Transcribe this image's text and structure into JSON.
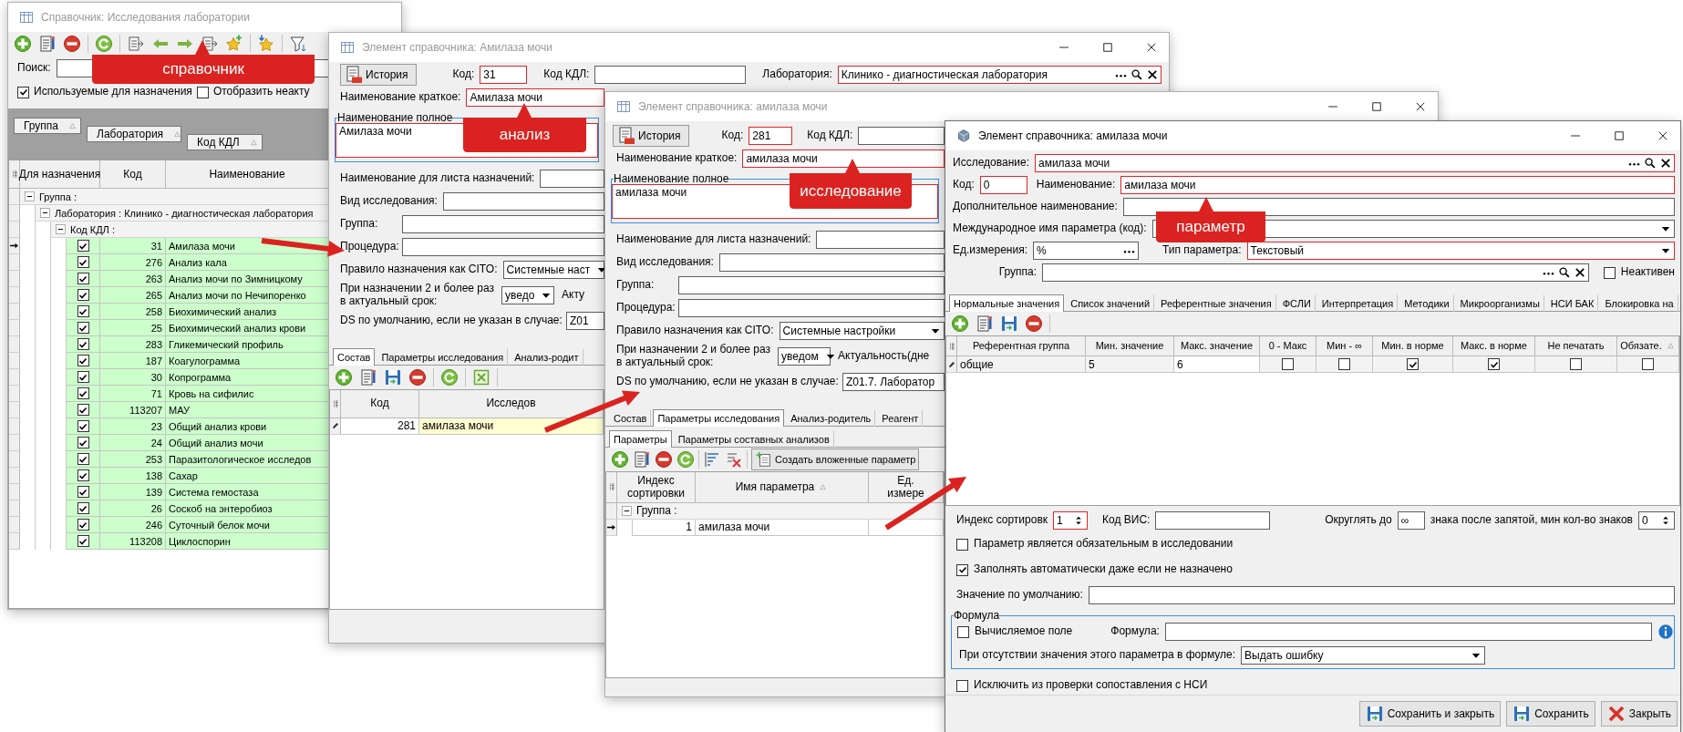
{
  "directory_window": {
    "title": "Справочник: Исследования лаборатории",
    "active": false,
    "search_label": "Поиск:",
    "options": [
      {
        "label": "Используемые для назначения",
        "checked": true
      },
      {
        "label": "Отобразить неакту",
        "checked": false
      }
    ],
    "group_chips": [
      "Группа",
      "Лаборатория",
      "Код КДЛ"
    ],
    "columns": [
      "Для назначения",
      "Код",
      "Наименование"
    ],
    "tree": [
      {
        "kind": "group",
        "label": "Группа :",
        "expanded": true,
        "children": [
          {
            "kind": "group",
            "label": "Лаборатория : Клинико - диагностическая лаборатория",
            "expanded": true,
            "children": [
              {
                "kind": "group",
                "label": "Код КДЛ :",
                "expanded": true,
                "children": [
                  {
                    "kind": "record",
                    "for_assignment": true,
                    "code": "31",
                    "name": "Амилаза мочи",
                    "selected": true
                  },
                  {
                    "kind": "record",
                    "for_assignment": true,
                    "code": "276",
                    "name": "Анализ кала",
                    "selected": false
                  },
                  {
                    "kind": "record",
                    "for_assignment": true,
                    "code": "263",
                    "name": "Анализ мочи по Зимницкому",
                    "selected": false
                  },
                  {
                    "kind": "record",
                    "for_assignment": true,
                    "code": "265",
                    "name": "Анализ мочи по Нечипоренко",
                    "selected": false
                  },
                  {
                    "kind": "record",
                    "for_assignment": true,
                    "code": "258",
                    "name": "Биохимический анализ",
                    "selected": false
                  },
                  {
                    "kind": "record",
                    "for_assignment": true,
                    "code": "25",
                    "name": "Биохимический анализ крови",
                    "selected": false
                  },
                  {
                    "kind": "record",
                    "for_assignment": true,
                    "code": "283",
                    "name": "Гликемический профиль",
                    "selected": false
                  },
                  {
                    "kind": "record",
                    "for_assignment": true,
                    "code": "187",
                    "name": "Коагулограмма",
                    "selected": false
                  },
                  {
                    "kind": "record",
                    "for_assignment": true,
                    "code": "30",
                    "name": "Копрограмма",
                    "selected": false
                  },
                  {
                    "kind": "record",
                    "for_assignment": true,
                    "code": "71",
                    "name": "Кровь на сифилис",
                    "selected": false
                  },
                  {
                    "kind": "record",
                    "for_assignment": true,
                    "code": "113207",
                    "name": "МАУ",
                    "selected": false
                  },
                  {
                    "kind": "record",
                    "for_assignment": true,
                    "code": "23",
                    "name": "Общий анализ крови",
                    "selected": false
                  },
                  {
                    "kind": "record",
                    "for_assignment": true,
                    "code": "24",
                    "name": "Общий анализ мочи",
                    "selected": false
                  },
                  {
                    "kind": "record",
                    "for_assignment": true,
                    "code": "253",
                    "name": "Паразитологическое исследов",
                    "selected": false
                  },
                  {
                    "kind": "record",
                    "for_assignment": true,
                    "code": "138",
                    "name": "Сахар",
                    "selected": false
                  },
                  {
                    "kind": "record",
                    "for_assignment": true,
                    "code": "139",
                    "name": "Система гемостаза",
                    "selected": false
                  },
                  {
                    "kind": "record",
                    "for_assignment": true,
                    "code": "26",
                    "name": "Соскоб на энтеробиоз",
                    "selected": false
                  },
                  {
                    "kind": "record",
                    "for_assignment": true,
                    "code": "246",
                    "name": "Суточный белок мочи",
                    "selected": false
                  },
                  {
                    "kind": "record",
                    "for_assignment": true,
                    "code": "113208",
                    "name": "Циклоспорин",
                    "selected": false
                  }
                ]
              }
            ]
          }
        ]
      }
    ]
  },
  "analysis_window": {
    "title": "Элемент справочника: Амилаза мочи",
    "active": false,
    "history_button": "История",
    "code": {
      "label": "Код:",
      "value": "31",
      "required": true
    },
    "kdl_code": {
      "label": "Код КДЛ:",
      "required": false
    },
    "laboratory": {
      "label": "Лаборатория:",
      "value": "Клинико - диагностическая лаборатория",
      "required": true
    },
    "short_name": {
      "label": "Наименование краткое:",
      "value": "Амилаза мочи",
      "required": true
    },
    "full_name": {
      "label": "Наименование полное",
      "value": "Амилаза мочи",
      "required": true
    },
    "sheet_name": {
      "label": "Наименование для листа назначений:",
      "required": false
    },
    "study_type": {
      "label": "Вид исследования:",
      "required": false
    },
    "group": {
      "label": "Группа:",
      "required": false
    },
    "procedure": {
      "label": "Процедура:",
      "required": false
    },
    "cito_rule": {
      "label": "Правило назначения как CITO:",
      "value": "Системные наст",
      "required": false
    },
    "repeat_rule": {
      "label": "При назначении 2 и более раз\nв актуальный срок:",
      "value": "уведо",
      "required": false
    },
    "actuality_label": "Акту",
    "ds_default": {
      "label": "DS по умолчанию, если не указан в случае:",
      "value": "Z01",
      "required": false
    },
    "tabs": [
      {
        "label": "Состав",
        "selected": true
      },
      {
        "label": "Параметры исследования",
        "selected": false
      },
      {
        "label": "Анализ-родит",
        "selected": false
      }
    ],
    "columns": [
      "Код",
      "Исследов"
    ],
    "rows": [
      {
        "code": "281",
        "name": "амилаза мочи",
        "editing": true
      }
    ]
  },
  "study_window": {
    "title": "Элемент справочника: амилаза мочи",
    "active": false,
    "history_button": "История",
    "code": {
      "label": "Код:",
      "value": "281",
      "required": true
    },
    "kdl_code": {
      "label": "Код КДЛ:",
      "required": false
    },
    "short_name": {
      "label": "Наименование краткое:",
      "value": "амилаза мочи",
      "required": true
    },
    "full_name": {
      "label": "Наименование полное",
      "value": "амилаза мочи",
      "required": true
    },
    "sheet_name": {
      "label": "Наименование для листа назначений:",
      "required": false
    },
    "study_type": {
      "label": "Вид исследования:",
      "required": false
    },
    "group": {
      "label": "Группа:",
      "required": false
    },
    "procedure": {
      "label": "Процедура:",
      "required": false
    },
    "cito_rule": {
      "label": "Правило назначения как CITO:",
      "value": "Системные настройки",
      "required": false
    },
    "repeat_rule": {
      "label": "При назначении 2 и более раз\nв актуальный срок:",
      "value": "уведом",
      "required": false
    },
    "actuality_label": "Актуальность(дне",
    "ds_default": {
      "label": "DS по умолчанию, если не указан в случае:",
      "value": "Z01.7. Лаборатор",
      "required": false
    },
    "tabs": [
      {
        "label": "Состав",
        "selected": false
      },
      {
        "label": "Параметры исследования",
        "selected": true
      },
      {
        "label": "Анализ-родитель",
        "selected": false
      },
      {
        "label": "Реагент",
        "selected": false
      }
    ],
    "subtabs": [
      {
        "label": "Параметры",
        "selected": true
      },
      {
        "label": "Параметры составных анализов",
        "selected": false
      }
    ],
    "create_button": "Создать вложенные параметр",
    "columns": [
      "Индекс\nсортировки",
      "Имя параметра",
      "Ед.\nизмере"
    ],
    "groups": [
      {
        "label": "Группа :",
        "expanded": true,
        "children": [
          {
            "index": "1",
            "name": "амилаза мочи",
            "selected": true
          }
        ]
      }
    ]
  },
  "parameter_window": {
    "title": "Элемент справочника: амилаза мочи",
    "active": true,
    "study": {
      "label": "Исследование:",
      "value": "амилаза мочи",
      "required": true
    },
    "code": {
      "label": "Код:",
      "value": "0",
      "required": true
    },
    "name": {
      "label": "Наименование:",
      "value": "амилаза мочи",
      "required": true
    },
    "extra_name": {
      "label": "Дополнительное наименование:",
      "required": false
    },
    "intl_name": {
      "label": "Международное имя параметра (код):",
      "required": false
    },
    "unit": {
      "label": "Ед.измерения:",
      "value": "%",
      "required": false
    },
    "param_type": {
      "label": "Тип параметра:",
      "value": "Текстовый",
      "required": true
    },
    "group": {
      "label": "Группа:",
      "required": false
    },
    "inactive": {
      "label": "Неактивен",
      "checked": false
    },
    "tabs": [
      {
        "label": "Нормальные значения",
        "selected": true
      },
      {
        "label": "Список значений",
        "selected": false
      },
      {
        "label": "Референтные значения",
        "selected": false
      },
      {
        "label": "ФСЛИ",
        "selected": false
      },
      {
        "label": "Интерпретация",
        "selected": false
      },
      {
        "label": "Методики",
        "selected": false
      },
      {
        "label": "Микроорганизмы",
        "selected": false
      },
      {
        "label": "НСИ БАК",
        "selected": false
      },
      {
        "label": "Блокировка на",
        "selected": false
      }
    ],
    "columns": [
      "Референтная группа",
      "Мин. значение",
      "Макс. значение",
      "0 - Макс",
      "Мин - ∞",
      "Мин. в норме",
      "Макс. в норме",
      "Не печатать",
      "Обязате."
    ],
    "rows": [
      {
        "group": "общие",
        "min": "5",
        "max": "6",
        "editing": true,
        "flags": [
          {
            "checked": false
          },
          {
            "checked": false
          },
          {
            "checked": true
          },
          {
            "checked": true
          },
          {
            "checked": false
          },
          {
            "checked": false
          }
        ]
      }
    ],
    "sort_index": {
      "label": "Индекс сортировк",
      "value": "1",
      "required": true
    },
    "vis_code": {
      "label": "Код ВИС:",
      "required": false
    },
    "round_label": "Округлять до",
    "round_value": "∞",
    "round_suffix": "знака после запятой, мин кол-во знаков",
    "min_digits": "0",
    "options": [
      {
        "label": "Параметр является обязательным в исследовании",
        "checked": false
      },
      {
        "label": "Заполнять автоматически даже если не назначено",
        "checked": true
      }
    ],
    "default_value": {
      "label": "Значение по умолчанию:",
      "required": false
    },
    "formula": {
      "title": "Формула",
      "computed": {
        "label": "Вычисляемое поле",
        "checked": false
      },
      "formula_label": "Формула:",
      "missing_label": "При отсутствии значения этого параметра в формуле:",
      "missing_value": "Выдать ошибку"
    },
    "exclude_nsi": {
      "label": "Исключить из проверки сопоставления с НСИ",
      "checked": false
    },
    "buttons": [
      {
        "label": "Сохранить и закрыть",
        "kind": "save"
      },
      {
        "label": "Сохранить",
        "kind": "save"
      },
      {
        "label": "Закрыть",
        "kind": "close"
      }
    ]
  },
  "callouts": [
    "справочник",
    "анализ",
    "исследование",
    "параметр"
  ]
}
